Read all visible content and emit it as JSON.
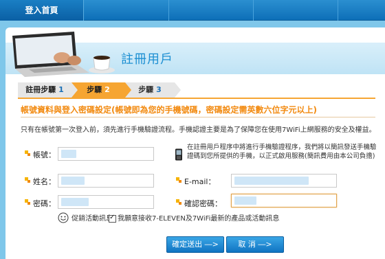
{
  "nav": {
    "home_tab": "登入首頁"
  },
  "page": {
    "title": "註冊用戶"
  },
  "steps": [
    {
      "label": "註冊步驟",
      "num": "1",
      "state": "done"
    },
    {
      "label": "步驟",
      "num": "2",
      "state": "active"
    },
    {
      "label": "步驟",
      "num": "3",
      "state": "pending"
    }
  ],
  "section": {
    "title": "帳號資料與登入密碼設定(帳號即為您的手機號碼，密碼設定需英數六位字元以上)"
  },
  "notice": "只有在帳號第一次登入前，須先進行手機驗證流程。手機認證主要是為了保障您在使用7WiFi上網服務的安全及權益。",
  "form": {
    "account_label": "帳號：",
    "name_label": "姓名：",
    "password_label": "密碼：",
    "email_label": "E-mail：",
    "confirm_label": "確認密碼："
  },
  "sms_note": {
    "line1": "在註冊用戶程序中將進行手機驗證程序，我們將以簡訊發送手機驗",
    "line2": "證碼到您所提供的手機，以正式啟用服務(簡訊費用由本公司負擔)"
  },
  "promo": {
    "label": "促銷活動訊息",
    "checkbox_text": "我願意接收7-ELEVEN及7WiFi最新的產品或活動訊息",
    "checked": true
  },
  "buttons": {
    "submit": "確定送出 ―>",
    "cancel": "取 消 ―>"
  },
  "colors": {
    "accent_orange": "#f28a10",
    "title_blue": "#1c8fd2",
    "button_blue": "#0f74c2"
  }
}
